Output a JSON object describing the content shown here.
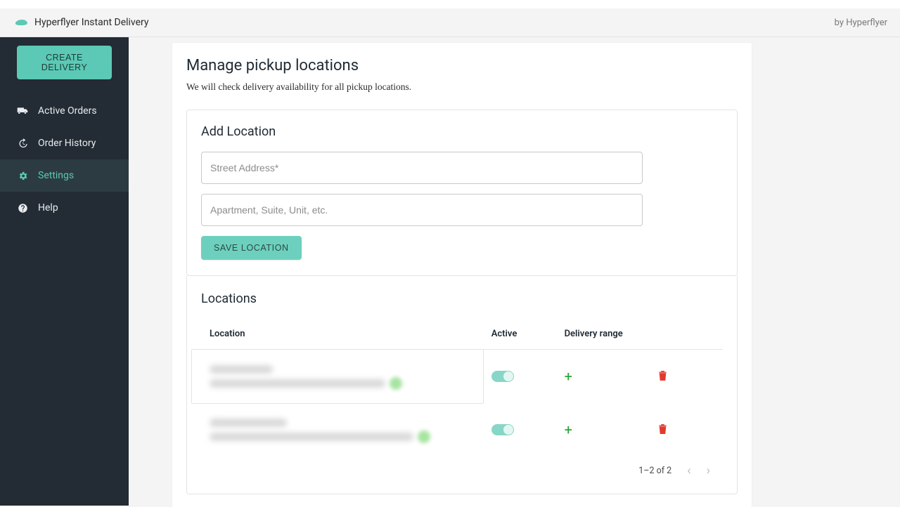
{
  "appbar": {
    "title": "Hyperflyer Instant Delivery",
    "by_text": "by Hyperflyer"
  },
  "sidebar": {
    "create_label": "CREATE DELIVERY",
    "items": [
      {
        "label": "Active Orders",
        "icon": "truck-icon",
        "active": false
      },
      {
        "label": "Order History",
        "icon": "history-icon",
        "active": false
      },
      {
        "label": "Settings",
        "icon": "gear-icon",
        "active": true
      },
      {
        "label": "Help",
        "icon": "help-icon",
        "active": false
      }
    ]
  },
  "page": {
    "title": "Manage pickup locations",
    "subtitle": "We will check delivery availability for all pickup locations."
  },
  "add_location": {
    "title": "Add Location",
    "street_placeholder": "Street Address*",
    "unit_placeholder": "Apartment, Suite, Unit, etc.",
    "save_label": "SAVE LOCATION"
  },
  "locations": {
    "title": "Locations",
    "columns": {
      "location": "Location",
      "active": "Active",
      "range": "Delivery range"
    },
    "rows": [
      {
        "line1_blur_width": 90,
        "line2_blur_width": 250,
        "active": true,
        "selected": true
      },
      {
        "line1_blur_width": 110,
        "line2_blur_width": 290,
        "active": true,
        "selected": false
      }
    ],
    "pagination": {
      "text": "1–2 of 2"
    }
  },
  "colors": {
    "accent": "#5bc9b5",
    "sidebar_bg": "#232b34",
    "danger": "#e23a2e",
    "success": "#2aa336"
  }
}
